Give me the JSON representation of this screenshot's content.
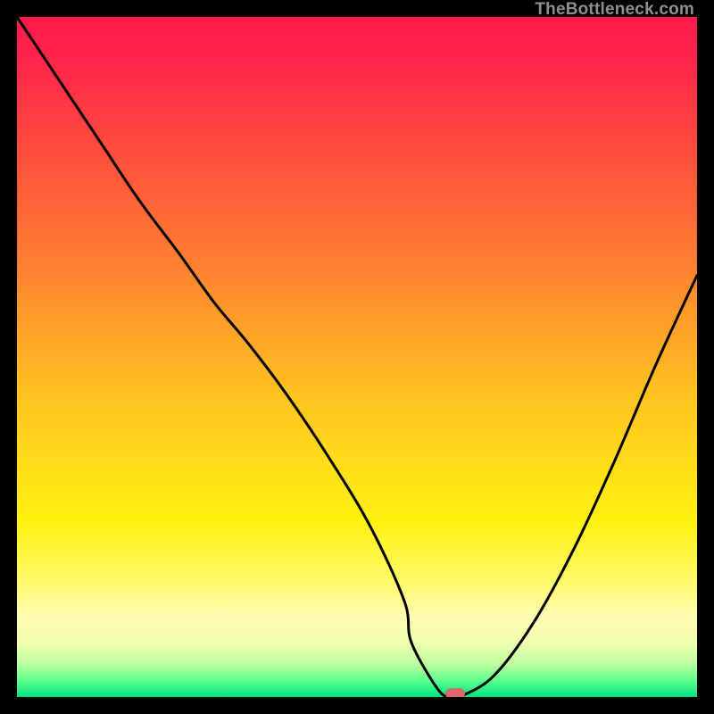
{
  "watermark": "TheBottleneck.com",
  "chart_data": {
    "type": "line",
    "title": "",
    "xlabel": "",
    "ylabel": "",
    "xlim": [
      0,
      100
    ],
    "ylim": [
      0,
      100
    ],
    "background_gradient": {
      "top": "#ff1a4d",
      "mid": "#ffde18",
      "bottom": "#00e57f"
    },
    "series": [
      {
        "name": "bottleneck-curve",
        "x": [
          0,
          6,
          12,
          18,
          24,
          29,
          34,
          40,
          46,
          52,
          57,
          58,
          62,
          64,
          65,
          70,
          76,
          82,
          88,
          94,
          100
        ],
        "y": [
          100,
          91,
          82,
          73,
          65,
          58,
          52,
          44,
          35,
          25,
          14,
          8,
          1,
          0,
          0,
          3,
          11,
          22,
          35,
          49,
          62
        ]
      }
    ],
    "marker": {
      "x": 64.5,
      "y": 0.5,
      "color": "#d86a6a"
    }
  }
}
